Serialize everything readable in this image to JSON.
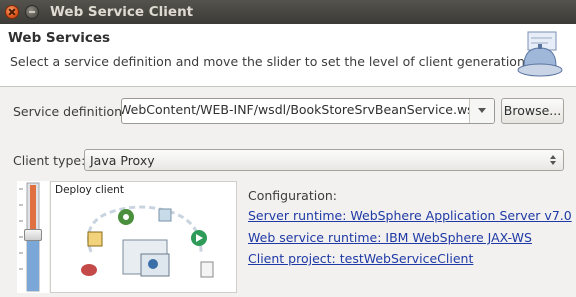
{
  "window": {
    "title": "Web Service Client"
  },
  "header": {
    "title": "Web Services",
    "description": "Select a service definition and move the slider to set the level of client generation."
  },
  "service_definition": {
    "label": "Service definition:",
    "value": "WebContent/WEB-INF/wsdl/BookStoreSrvBeanService.wsdl",
    "browse_label": "Browse..."
  },
  "client_type": {
    "label": "Client type:",
    "value": "Java Proxy"
  },
  "slider": {
    "stage_label": "Deploy client",
    "level_fraction": 0.5
  },
  "configuration": {
    "heading": "Configuration:",
    "server_runtime": "Server runtime: WebSphere Application Server v7.0",
    "ws_runtime": "Web service runtime: IBM WebSphere JAX-WS",
    "client_project": "Client project: testWebServiceClient"
  },
  "colors": {
    "link": "#1f3aa5",
    "slider_fill": "#e07040",
    "slider_track": "#7aa7d8"
  }
}
